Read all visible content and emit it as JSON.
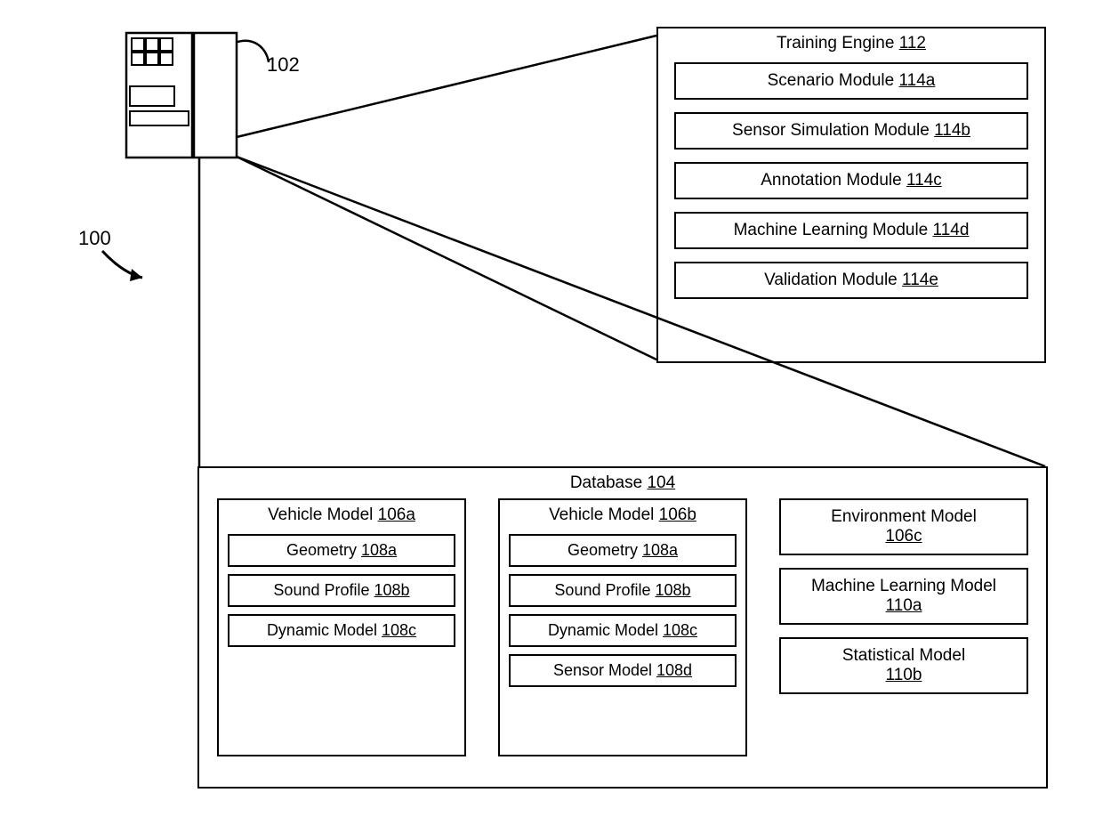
{
  "figure_label": "100",
  "computer_label": "102",
  "training_engine": {
    "title": "Training Engine",
    "ref": "112",
    "modules": [
      {
        "name": "Scenario Module",
        "ref": "114a"
      },
      {
        "name": "Sensor Simulation Module",
        "ref": "114b"
      },
      {
        "name": "Annotation Module",
        "ref": "114c"
      },
      {
        "name": "Machine Learning Module",
        "ref": "114d"
      },
      {
        "name": "Validation Module",
        "ref": "114e"
      }
    ]
  },
  "database": {
    "title": "Database",
    "ref": "104",
    "vehicle_a": {
      "title": "Vehicle Model",
      "ref": "106a",
      "items": [
        {
          "name": "Geometry",
          "ref": "108a"
        },
        {
          "name": "Sound Profile",
          "ref": "108b"
        },
        {
          "name": "Dynamic Model",
          "ref": "108c"
        }
      ]
    },
    "vehicle_b": {
      "title": "Vehicle Model",
      "ref": "106b",
      "items": [
        {
          "name": "Geometry",
          "ref": "108a"
        },
        {
          "name": "Sound Profile",
          "ref": "108b"
        },
        {
          "name": "Dynamic Model",
          "ref": "108c"
        },
        {
          "name": "Sensor Model",
          "ref": "108d"
        }
      ]
    },
    "col3": [
      {
        "name": "Environment Model",
        "ref": "106c"
      },
      {
        "name": "Machine Learning Model",
        "ref": "110a"
      },
      {
        "name": "Statistical Model",
        "ref": "110b"
      }
    ]
  }
}
